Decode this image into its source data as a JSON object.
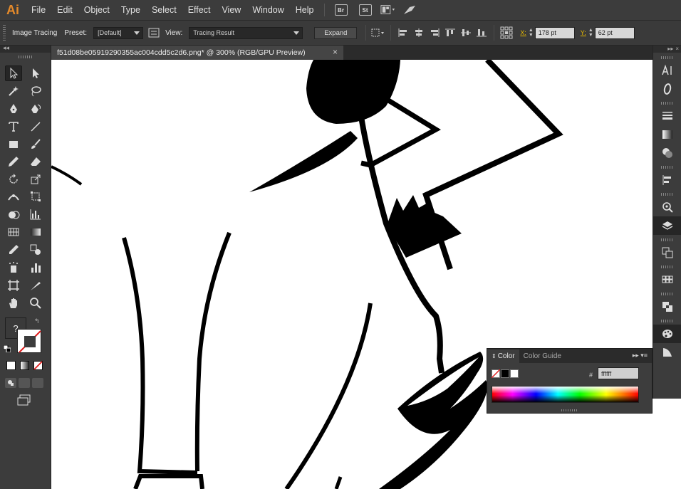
{
  "app": {
    "logo": "Ai"
  },
  "menubar": {
    "items": [
      "File",
      "Edit",
      "Object",
      "Type",
      "Select",
      "Effect",
      "View",
      "Window",
      "Help"
    ],
    "bridge_label": "Br",
    "stock_label": "St"
  },
  "controlbar": {
    "panel_title": "Image Tracing",
    "preset_label": "Preset:",
    "preset_value": "[Default]",
    "view_label": "View:",
    "view_value": "Tracing Result",
    "expand_label": "Expand",
    "x_label": "X:",
    "x_value": "178 pt",
    "y_label": "Y:",
    "y_value": "62 pt"
  },
  "document": {
    "tab_title": "f51d08be05919290355ac004cdd5c2d6.png* @ 300% (RGB/GPU Preview)",
    "close": "×"
  },
  "tools": {
    "unknown_fill": "?"
  },
  "color_panel": {
    "tabs": [
      "Color",
      "Color Guide"
    ],
    "hash": "#",
    "hex_value": "ffffff",
    "menu_glyph": "▸▸ ▾≡"
  },
  "colors": {
    "accent": "#e58a2a",
    "panel_bg": "#3c3c3c",
    "canvas_bg": "#ffffff",
    "artwork": "#000000"
  }
}
